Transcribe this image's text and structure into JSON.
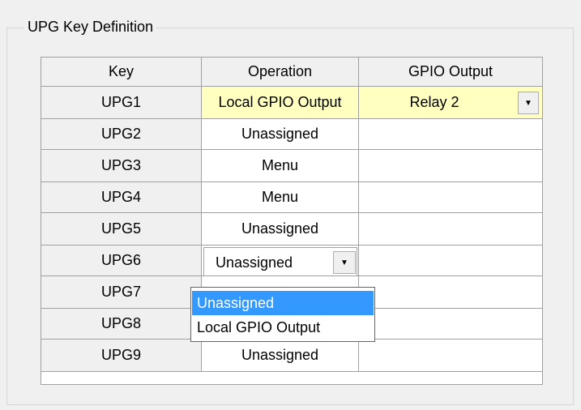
{
  "group": {
    "title": "UPG Key Definition"
  },
  "table": {
    "columns": [
      "Key",
      "Operation",
      "GPIO Output"
    ],
    "rows": [
      {
        "key": "UPG1",
        "operation": "Local GPIO Output",
        "gpio": "Relay 2"
      },
      {
        "key": "UPG2",
        "operation": "Unassigned",
        "gpio": ""
      },
      {
        "key": "UPG3",
        "operation": "Menu",
        "gpio": ""
      },
      {
        "key": "UPG4",
        "operation": "Menu",
        "gpio": ""
      },
      {
        "key": "UPG5",
        "operation": "Unassigned",
        "gpio": ""
      },
      {
        "key": "UPG6",
        "operation": "Unassigned",
        "gpio": ""
      },
      {
        "key": "UPG7",
        "operation": "",
        "gpio": ""
      },
      {
        "key": "UPG8",
        "operation": "",
        "gpio": ""
      },
      {
        "key": "UPG9",
        "operation": "Unassigned",
        "gpio": ""
      }
    ]
  },
  "dropdown": {
    "options": [
      "Unassigned",
      "Local GPIO Output"
    ],
    "selected": "Unassigned"
  },
  "colors": {
    "highlight_row": "#ffffc0",
    "selection": "#3399ff"
  },
  "icons": {
    "dropdown_arrow": "chevron-down-icon"
  }
}
